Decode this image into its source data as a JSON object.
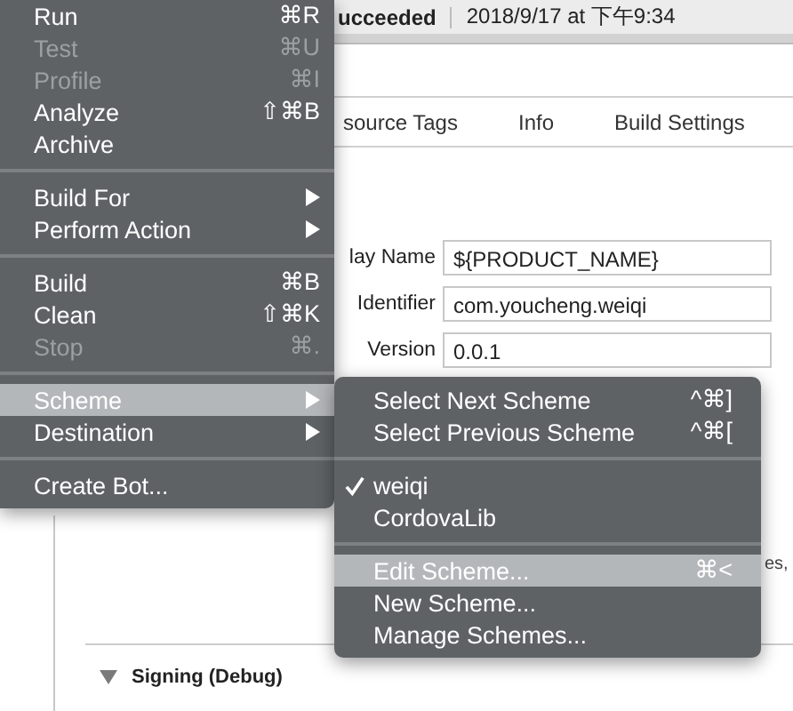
{
  "window": {
    "status": "ucceeded",
    "timestamp": "2018/9/17 at 下午9:34"
  },
  "tabs": [
    {
      "label": "source Tags"
    },
    {
      "label": "Info"
    },
    {
      "label": "Build Settings"
    }
  ],
  "fields": [
    {
      "label": "lay Name",
      "value": "${PRODUCT_NAME}"
    },
    {
      "label": "Identifier",
      "value": "com.youcheng.weiqi"
    },
    {
      "label": "Version",
      "value": "0.0.1"
    }
  ],
  "fragment": "es,",
  "section": {
    "title": "Signing (Debug)",
    "expanded": true
  },
  "menu": {
    "items": [
      {
        "kind": "item",
        "label": "Run",
        "shortcut": "⌘R",
        "disabled": false,
        "submenu": false,
        "selected": false
      },
      {
        "kind": "item",
        "label": "Test",
        "shortcut": "⌘U",
        "disabled": true,
        "submenu": false,
        "selected": false
      },
      {
        "kind": "item",
        "label": "Profile",
        "shortcut": "⌘I",
        "disabled": true,
        "submenu": false,
        "selected": false
      },
      {
        "kind": "item",
        "label": "Analyze",
        "shortcut": "⇧⌘B",
        "disabled": false,
        "submenu": false,
        "selected": false
      },
      {
        "kind": "item",
        "label": "Archive",
        "disabled": false,
        "submenu": false,
        "selected": false
      },
      {
        "kind": "separator"
      },
      {
        "kind": "item",
        "label": "Build For",
        "disabled": false,
        "submenu": true,
        "selected": false
      },
      {
        "kind": "item",
        "label": "Perform Action",
        "disabled": false,
        "submenu": true,
        "selected": false
      },
      {
        "kind": "separator"
      },
      {
        "kind": "item",
        "label": "Build",
        "shortcut": "⌘B",
        "disabled": false,
        "submenu": false,
        "selected": false
      },
      {
        "kind": "item",
        "label": "Clean",
        "shortcut": "⇧⌘K",
        "disabled": false,
        "submenu": false,
        "selected": false
      },
      {
        "kind": "item",
        "label": "Stop",
        "shortcut": "⌘.",
        "disabled": true,
        "submenu": false,
        "selected": false
      },
      {
        "kind": "separator"
      },
      {
        "kind": "item",
        "label": "Scheme",
        "disabled": false,
        "submenu": true,
        "selected": true
      },
      {
        "kind": "item",
        "label": "Destination",
        "disabled": false,
        "submenu": true,
        "selected": false
      },
      {
        "kind": "separator"
      },
      {
        "kind": "item",
        "label": "Create Bot...",
        "disabled": false,
        "submenu": false,
        "selected": false
      }
    ]
  },
  "submenu": {
    "items": [
      {
        "kind": "item",
        "label": "Select Next Scheme",
        "shortcut": "^⌘]",
        "disabled": false,
        "checked": false,
        "selected": false
      },
      {
        "kind": "item",
        "label": "Select Previous Scheme",
        "shortcut": "^⌘[",
        "disabled": false,
        "checked": false,
        "selected": false
      },
      {
        "kind": "separator"
      },
      {
        "kind": "item",
        "label": "weiqi",
        "disabled": false,
        "checked": true,
        "selected": false
      },
      {
        "kind": "item",
        "label": "CordovaLib",
        "disabled": false,
        "checked": false,
        "selected": false
      },
      {
        "kind": "separator"
      },
      {
        "kind": "item",
        "label": "Edit Scheme...",
        "shortcut": "⌘<",
        "disabled": false,
        "checked": false,
        "selected": true
      },
      {
        "kind": "item",
        "label": "New Scheme...",
        "disabled": false,
        "checked": false,
        "selected": false
      },
      {
        "kind": "item",
        "label": "Manage Schemes...",
        "disabled": false,
        "checked": false,
        "selected": false
      }
    ]
  }
}
